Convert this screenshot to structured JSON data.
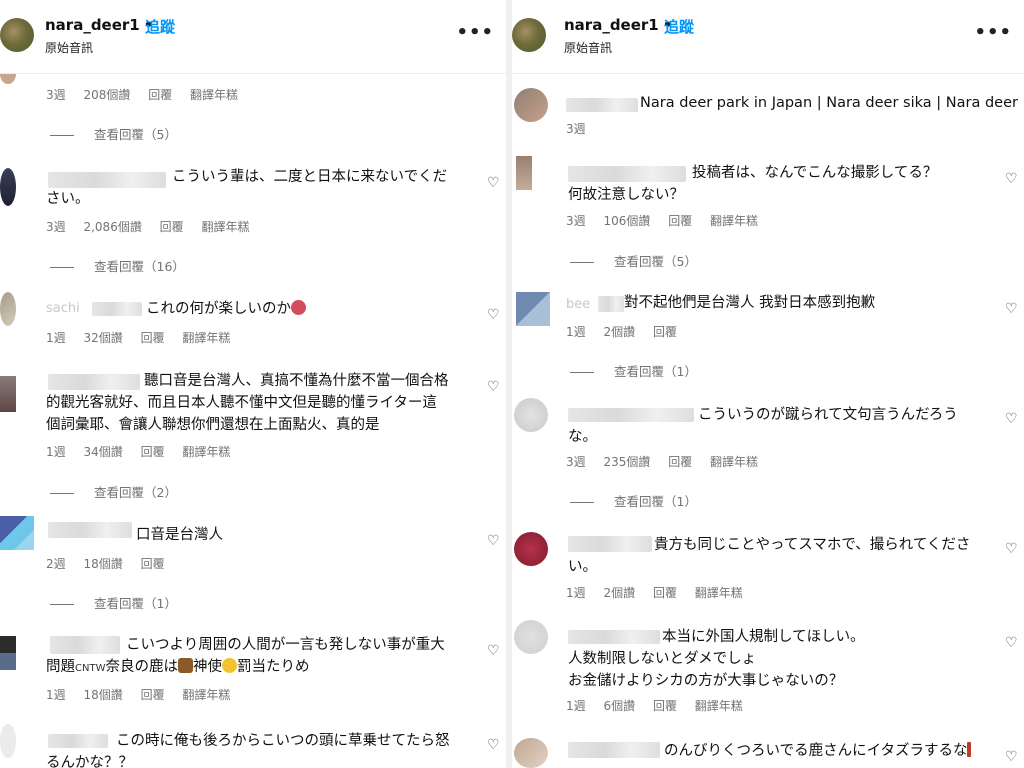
{
  "left": {
    "header": {
      "username": "nara_deer1",
      "dot": "•",
      "follow": "追蹤",
      "audio": "原始音訊",
      "more": "•••"
    },
    "top_meta": {
      "age": "3週",
      "likes": "208個讚",
      "reply": "回覆",
      "translate": "翻譯年糕"
    },
    "top_replies": "查看回覆（5）",
    "comments": [
      {
        "line1": "こういう輩は、二度と日本に来ないでくだ",
        "line2": "さい。",
        "age": "3週",
        "likes": "2,086個讚",
        "reply": "回覆",
        "translate": "翻譯年糕",
        "view_replies": "查看回覆（16）"
      },
      {
        "prefix": "sachi",
        "line1": "これの何が楽しいのか",
        "age": "1週",
        "likes": "32個讚",
        "reply": "回覆",
        "translate": "翻譯年糕"
      },
      {
        "line1": "聽口音是台灣人、真搞不懂為什麼不當一個合格",
        "line2": "的觀光客就好、而且日本人聽不懂中文但是聽的懂ライター這",
        "line3": "個詞彙耶、會讓人聯想你們還想在上面點火、真的是",
        "age": "1週",
        "likes": "34個讚",
        "reply": "回覆",
        "translate": "翻譯年糕",
        "view_replies": "查看回覆（2）"
      },
      {
        "line1": "口音是台灣人",
        "age": "2週",
        "likes": "18個讚",
        "reply": "回覆",
        "view_replies": "查看回覆（1）"
      },
      {
        "line1": "こいつより周囲の人間が一言も発しない事が重大",
        "line2a": "問題",
        "watermark": "CNTW",
        "line2b": "奈良の鹿は",
        "line2c": "神使",
        "line2d": "罰当たりめ",
        "age": "1週",
        "likes": "18個讚",
        "reply": "回覆",
        "translate": "翻譯年糕"
      },
      {
        "line1": "この時に俺も後ろからこいつの頭に草乗せてたら怒",
        "line2": "るんかな？？"
      }
    ]
  },
  "right": {
    "header": {
      "username": "nara_deer1",
      "dot": "•",
      "follow": "追蹤",
      "audio": "原始音訊",
      "more": "•••"
    },
    "comments": [
      {
        "line1": "Nara deer park in Japan | Nara deer sika | Nara deer",
        "age": "3週"
      },
      {
        "line1": "投稿者は、なんでこんな撮影してる？",
        "line2": "何故注意しない？",
        "age": "3週",
        "likes": "106個讚",
        "reply": "回覆",
        "translate": "翻譯年糕",
        "view_replies": "查看回覆（5）"
      },
      {
        "prefix": "bee",
        "line1": "對不起他們是台灣人 我對日本感到抱歉",
        "age": "1週",
        "likes": "2個讚",
        "reply": "回覆",
        "view_replies": "查看回覆（1）"
      },
      {
        "line1": "こういうのが蹴られて文句言うんだろう",
        "line2": "な。",
        "age": "3週",
        "likes": "235個讚",
        "reply": "回覆",
        "translate": "翻譯年糕",
        "view_replies": "查看回覆（1）"
      },
      {
        "line1": "貴方も同じことやってスマホで、撮られてくださ",
        "line2": "い。",
        "age": "1週",
        "likes": "2個讚",
        "reply": "回覆",
        "translate": "翻譯年糕"
      },
      {
        "line1": "本当に外国人規制してほしい。",
        "line2": "人数制限しないとダメでしょ",
        "line3": "お金儲けよりシカの方が大事じゃないの？",
        "age": "1週",
        "likes": "6個讚",
        "reply": "回覆",
        "translate": "翻譯年糕"
      },
      {
        "line1": "のんびりくつろいでる鹿さんにイタズラするな"
      }
    ]
  }
}
